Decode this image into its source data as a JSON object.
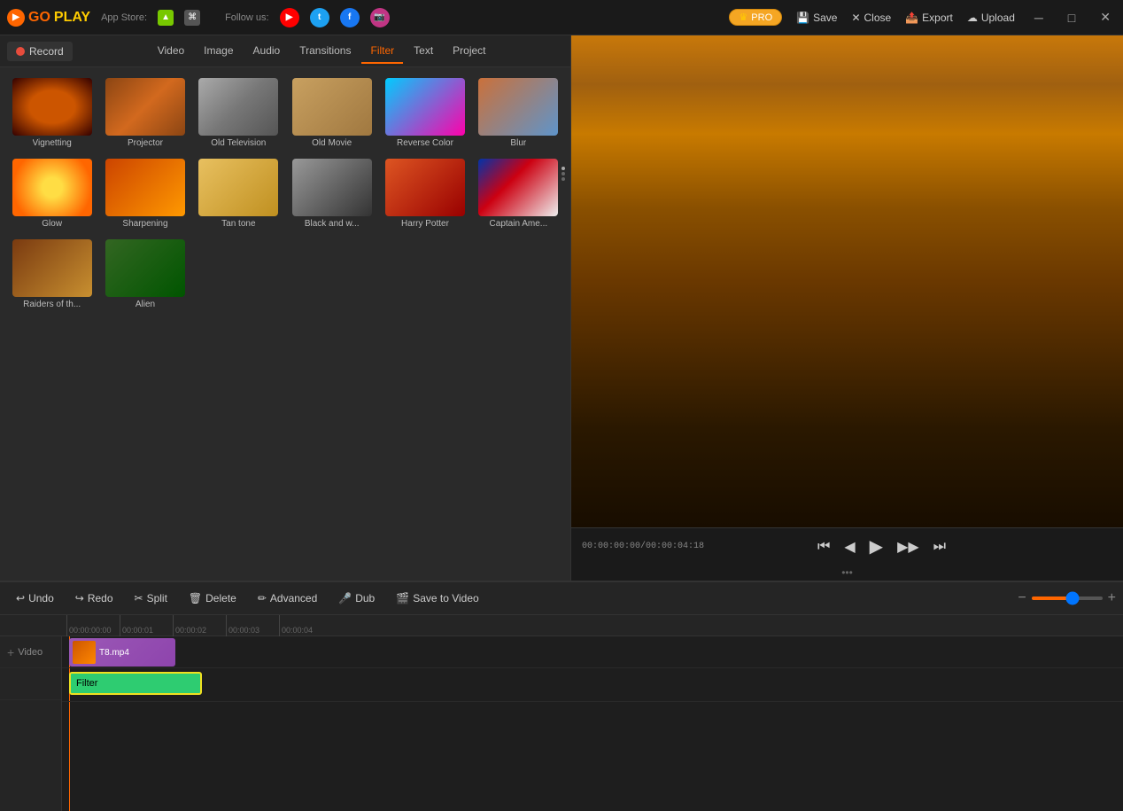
{
  "app": {
    "name": "GOPLAY",
    "logo_go": "GO",
    "logo_play": "PLAY"
  },
  "topbar": {
    "appstore_label": "App Store:",
    "followus_label": "Follow us:",
    "pro_label": "PRO",
    "save_label": "Save",
    "close_label": "Close",
    "export_label": "Export",
    "upload_label": "Upload"
  },
  "toolbar": {
    "record_label": "Record",
    "tabs": [
      "Video",
      "Image",
      "Audio",
      "Transitions",
      "Filter",
      "Text",
      "Project"
    ],
    "active_tab": "Filter"
  },
  "filters": [
    {
      "id": "vignetting",
      "label": "Vignetting",
      "thumb_class": "thumb-vignetting"
    },
    {
      "id": "projector",
      "label": "Projector",
      "thumb_class": "thumb-projector"
    },
    {
      "id": "old-tv",
      "label": "Old Television",
      "thumb_class": "thumb-old-tv"
    },
    {
      "id": "old-movie",
      "label": "Old Movie",
      "thumb_class": "thumb-old-movie"
    },
    {
      "id": "reverse",
      "label": "Reverse Color",
      "thumb_class": "thumb-reverse"
    },
    {
      "id": "blur",
      "label": "Blur",
      "thumb_class": "thumb-blur"
    },
    {
      "id": "glow",
      "label": "Glow",
      "thumb_class": "thumb-glow"
    },
    {
      "id": "sharpening",
      "label": "Sharpening",
      "thumb_class": "thumb-sharpening"
    },
    {
      "id": "tan",
      "label": "Tan tone",
      "thumb_class": "thumb-tan"
    },
    {
      "id": "bw",
      "label": "Black and w...",
      "thumb_class": "thumb-bw"
    },
    {
      "id": "harry",
      "label": "Harry Potter",
      "thumb_class": "thumb-harry"
    },
    {
      "id": "captain",
      "label": "Captain Ame...",
      "thumb_class": "thumb-captain"
    },
    {
      "id": "raiders",
      "label": "Raiders of th...",
      "thumb_class": "thumb-raiders"
    },
    {
      "id": "alien",
      "label": "Alien",
      "thumb_class": "thumb-alien"
    }
  ],
  "timecode": {
    "current": "00:00:00:00/00:00:04:18"
  },
  "bottom_toolbar": {
    "undo": "Undo",
    "redo": "Redo",
    "split": "Split",
    "delete": "Delete",
    "advanced": "Advanced",
    "dub": "Dub",
    "save_to_video": "Save to Video"
  },
  "timeline": {
    "ruler_marks": [
      "00:00:00:00",
      "00:00:01:00",
      "00:00:02:00",
      "00:00:03:00",
      "00:00:04:00"
    ],
    "video_track_label": "Video",
    "video_clip_name": "T8.mp4",
    "filter_clip_name": "Filter"
  }
}
